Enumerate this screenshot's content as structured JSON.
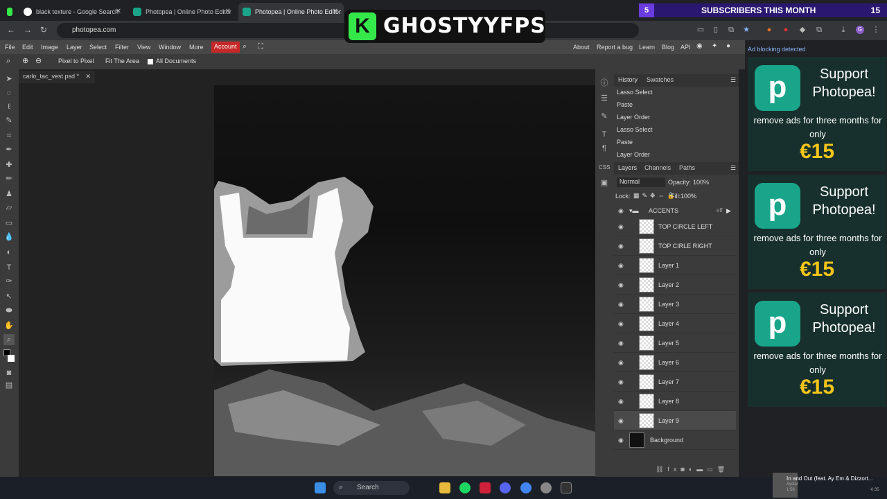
{
  "browser": {
    "tabs": [
      {
        "title": "black texture - Google Search"
      },
      {
        "title": "Photopea | Online Photo Editor"
      },
      {
        "title": "Photopea | Online Photo Editor"
      }
    ],
    "url": "photopea.com"
  },
  "menu": {
    "items": [
      "File",
      "Edit",
      "Image",
      "Layer",
      "Select",
      "Filter",
      "View",
      "Window",
      "More"
    ],
    "account": "Account",
    "right_items": [
      "About",
      "Report a bug",
      "Learn",
      "Blog",
      "API"
    ]
  },
  "options": {
    "pixel_to_pixel": "Pixel to Pixel",
    "fit_area": "Fit The Area",
    "all_documents": "All Documents"
  },
  "document": {
    "tab_title": "carlo_tac_vest.psd *"
  },
  "history": {
    "tabs": [
      "History",
      "Swatches"
    ],
    "items": [
      "Lasso Select",
      "Paste",
      "Layer Order",
      "Lasso Select",
      "Paste",
      "Layer Order"
    ]
  },
  "layers": {
    "tabs": [
      "Layers",
      "Channels",
      "Paths"
    ],
    "blend_mode": "Normal",
    "opacity_label": "Opacity:",
    "opacity": "100%",
    "lock_label": "Lock:",
    "fill_label": "Fill:",
    "fill": "100%",
    "group": "ACCENTS",
    "group_fx": "eff",
    "items": [
      "TOP CIRCLE LEFT",
      "TOP CIRLE RIGHT",
      "Layer 1",
      "Layer 2",
      "Layer 3",
      "Layer 4",
      "Layer 5",
      "Layer 6",
      "Layer 7",
      "Layer 8",
      "Layer 9",
      "Background"
    ]
  },
  "ads": {
    "notice": "Ad blocking detected",
    "title": "Support Photopea!",
    "body": "remove ads for three months for only",
    "price": "€15"
  },
  "overlay": {
    "logo_letter": "K",
    "logo_name": "GHOSTYYFPS",
    "subs_count_left": "5",
    "subs_text": "SUBSCRIBERS THIS MONTH",
    "subs_count_right": "15"
  },
  "taskbar": {
    "search": "Search",
    "media_title": "In and Out (feat. Ay Em & Dizzort...",
    "media_artist": "Aystar",
    "media_time": "1:56",
    "media_remaining": "-0:35"
  },
  "colors": {
    "accent_red": "#c62828",
    "ad_green": "#19a58a",
    "price_yellow": "#f5c518",
    "subs_purple": "#6a3ce0"
  }
}
